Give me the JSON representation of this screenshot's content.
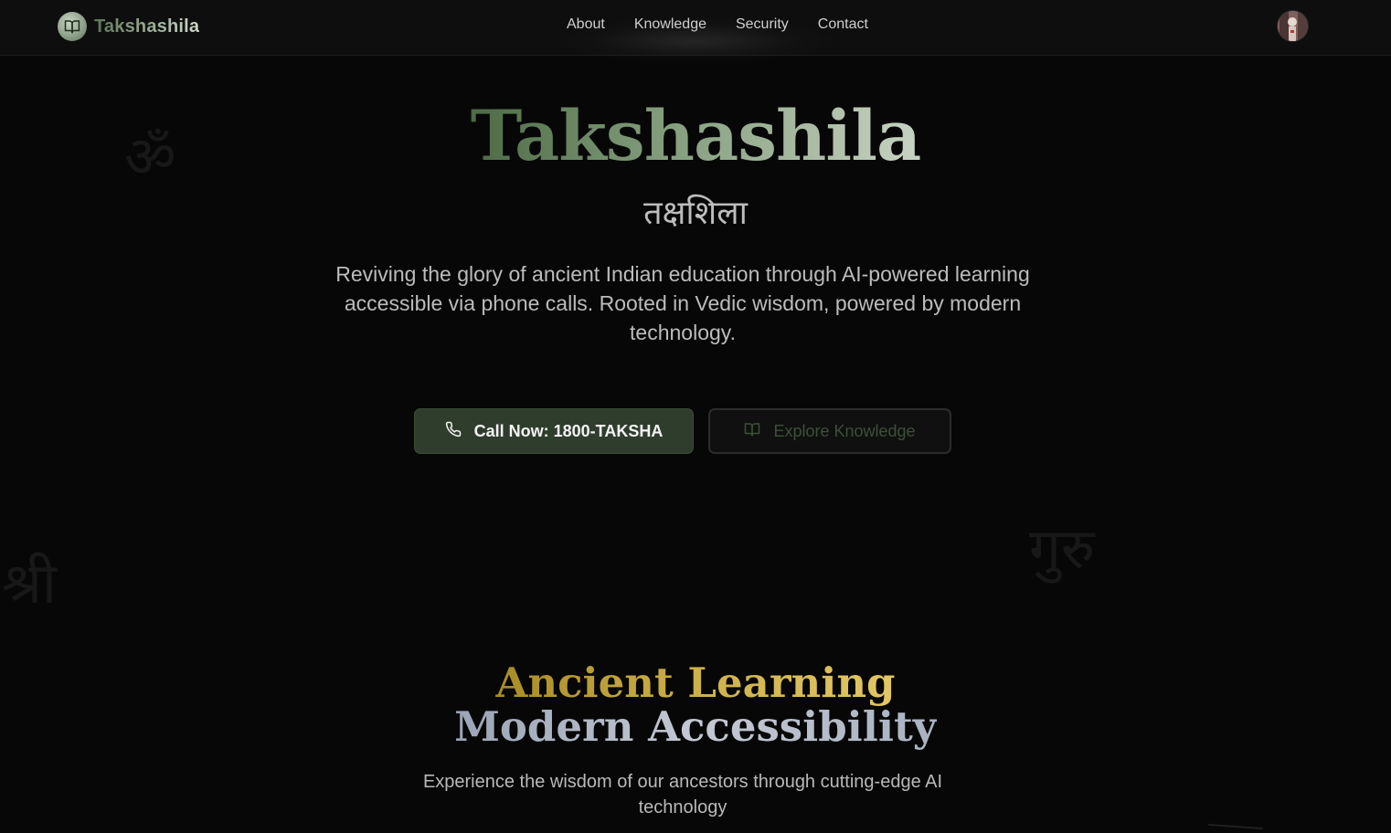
{
  "nav": {
    "brand_name": "Takshashila",
    "brand_icon": "open-book-icon",
    "links": [
      {
        "label": "About"
      },
      {
        "label": "Knowledge"
      },
      {
        "label": "Security"
      },
      {
        "label": "Contact"
      }
    ]
  },
  "decor": {
    "om": "ॐ",
    "shri": "श्री",
    "guru": "गुरु"
  },
  "hero": {
    "title": "Takshashila",
    "subtitle": "तक्षशिला",
    "description": "Reviving the glory of ancient Indian education through AI-powered learning accessible via phone calls. Rooted in Vedic wisdom, powered by modern technology.",
    "call_button_label": "Call Now: 1800-TAKSHA",
    "call_button_icon": "phone-icon",
    "explore_button_label": "Explore Knowledge",
    "explore_button_icon": "open-book-icon"
  },
  "section2": {
    "line1": "Ancient Learning",
    "line2": "Modern Accessibility",
    "description": "Experience the wisdom of our ancestors through cutting-edge AI technology"
  },
  "colors": {
    "background": "#070707",
    "accent_green": "#2f3e2c",
    "accent_gold": "#cdb04b"
  }
}
